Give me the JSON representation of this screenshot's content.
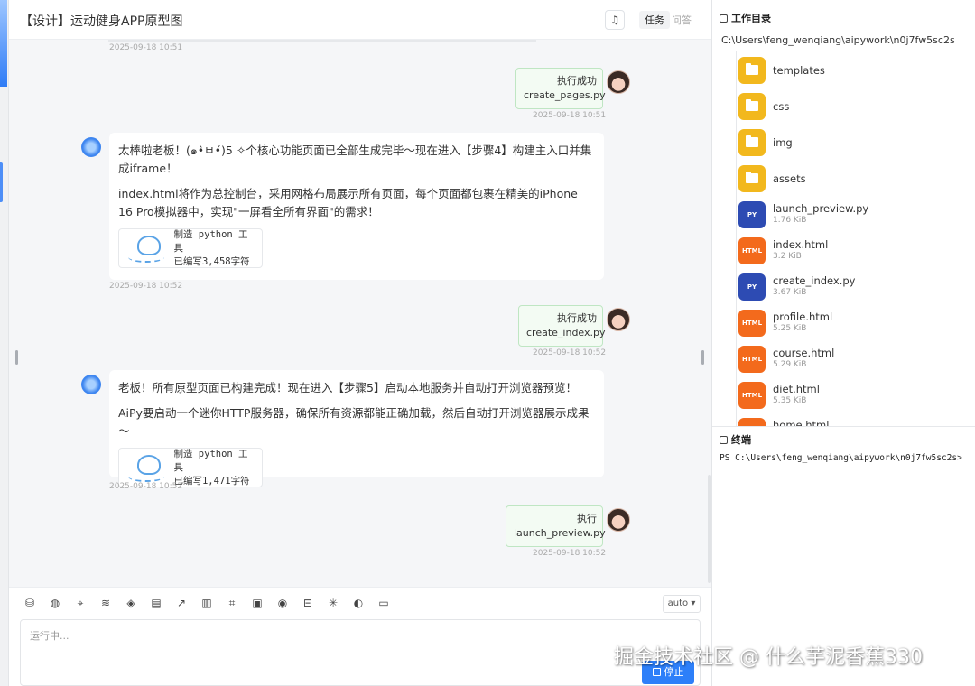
{
  "header": {
    "title": "【设计】运动健身APP原型图",
    "tab_task": "任务",
    "tab_ask": "问答"
  },
  "messages": {
    "ts0": "2025-09-18 10:51",
    "u1": {
      "line1": "执行成功",
      "line2": "create_pages.py",
      "ts": "2025-09-18 10:51"
    },
    "b1": {
      "p1": "太棒啦老板！(๑•̀ㅂ•́)5 ✧个核心功能页面已全部生成完毕～现在进入【步骤4】构建主入口并集成iframe！",
      "p2": "index.html将作为总控制台，采用网格布局展示所有页面，每个页面都包裹在精美的iPhone 16 Pro模拟器中，实现\"一屏看全所有界面\"的需求！",
      "tool_line1": "制造 python 工具",
      "tool_line2": "已编写3,458字符",
      "ts": "2025-09-18 10:52"
    },
    "u2": {
      "line1": "执行成功",
      "line2": "create_index.py",
      "ts": "2025-09-18 10:52"
    },
    "b2": {
      "p1": "老板！所有原型页面已构建完成！现在进入【步骤5】启动本地服务并自动打开浏览器预览！",
      "p2": "AiPy要启动一个迷你HTTP服务器，确保所有资源都能正确加载，然后自动打开浏览器展示成果～",
      "tool_line1": "制造 python 工具",
      "tool_line2": "已编写1,471字符",
      "ts": "2025-09-18 10:52"
    },
    "u3": {
      "line1": "执行",
      "line2": "launch_preview.py",
      "ts": "2025-09-18 10:52"
    }
  },
  "toolbar": {
    "mode": "auto ▾",
    "icons": [
      "database-icon",
      "globe-icon",
      "location-icon",
      "signal-icon",
      "tag-icon",
      "document-icon",
      "chart-icon",
      "book-icon",
      "capture-icon",
      "image-icon",
      "weibo-icon",
      "server-icon",
      "sparkle-icon",
      "palette-icon",
      "monitor-icon"
    ]
  },
  "input": {
    "status": "运行中...",
    "stop_label": "停止"
  },
  "watermark": "掘金技术社区 @ 什么芋泥香蕉330",
  "workspace": {
    "title": "工作目录",
    "path": "C:\\Users\\feng_wenqiang\\aipywork\\n0j7fw5sc2s",
    "files": [
      {
        "name": "templates",
        "kind": "folder"
      },
      {
        "name": "css",
        "kind": "folder"
      },
      {
        "name": "img",
        "kind": "folder"
      },
      {
        "name": "assets",
        "kind": "folder"
      },
      {
        "name": "launch_preview.py",
        "kind": "py",
        "size": "1.76 KiB"
      },
      {
        "name": "index.html",
        "kind": "html",
        "size": "3.2 KiB"
      },
      {
        "name": "create_index.py",
        "kind": "py",
        "size": "3.67 KiB"
      },
      {
        "name": "profile.html",
        "kind": "html",
        "size": "5.25 KiB"
      },
      {
        "name": "course.html",
        "kind": "html",
        "size": "5.29 KiB"
      },
      {
        "name": "diet.html",
        "kind": "html",
        "size": "5.35 KiB"
      },
      {
        "name": "home.html",
        "kind": "html",
        "size": ""
      }
    ],
    "py_badge": "PY",
    "html_badge": "HTML"
  },
  "terminal": {
    "title": "终端",
    "prompt": "PS C:\\Users\\feng_wenqiang\\aipywork\\n0j7fw5sc2s>"
  }
}
